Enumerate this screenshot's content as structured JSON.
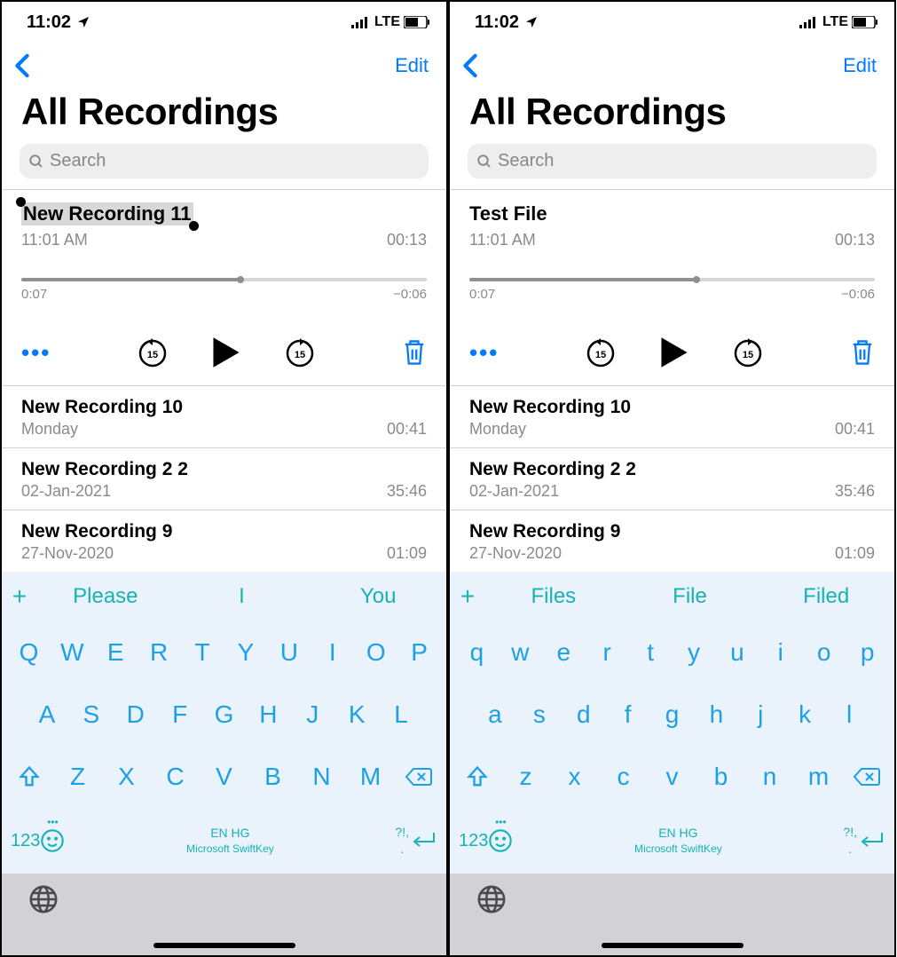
{
  "screens": [
    {
      "status": {
        "time": "11:02",
        "network": "LTE"
      },
      "nav": {
        "edit": "Edit"
      },
      "title": "All Recordings",
      "search_placeholder": "Search",
      "expanded": {
        "title": "New Recording 11",
        "title_selected": true,
        "time": "11:01 AM",
        "duration": "00:13",
        "elapsed": "0:07",
        "remaining": "−0:06",
        "progress": 0.54
      },
      "rows": [
        {
          "title": "New Recording 10",
          "date": "Monday",
          "dur": "00:41"
        },
        {
          "title": "New Recording 2 2",
          "date": "02-Jan-2021",
          "dur": "35:46"
        },
        {
          "title": "New Recording 9",
          "date": "27-Nov-2020",
          "dur": "01:09"
        }
      ],
      "suggestions": [
        "Please",
        "I",
        "You"
      ],
      "kb_rows": [
        [
          "Q",
          "W",
          "E",
          "R",
          "T",
          "Y",
          "U",
          "I",
          "O",
          "P"
        ],
        [
          "A",
          "S",
          "D",
          "F",
          "G",
          "H",
          "J",
          "K",
          "L"
        ],
        [
          "Z",
          "X",
          "C",
          "V",
          "B",
          "N",
          "M"
        ]
      ],
      "kb_bottom": {
        "num": "123",
        "lang": "EN HG",
        "brand": "Microsoft SwiftKey",
        "punct_top": "?!,",
        "punct_bot": "."
      }
    },
    {
      "status": {
        "time": "11:02",
        "network": "LTE"
      },
      "nav": {
        "edit": "Edit"
      },
      "title": "All Recordings",
      "search_placeholder": "Search",
      "expanded": {
        "title": "Test File",
        "title_selected": false,
        "time": "11:01 AM",
        "duration": "00:13",
        "elapsed": "0:07",
        "remaining": "−0:06",
        "progress": 0.56
      },
      "rows": [
        {
          "title": "New Recording 10",
          "date": "Monday",
          "dur": "00:41"
        },
        {
          "title": "New Recording 2 2",
          "date": "02-Jan-2021",
          "dur": "35:46"
        },
        {
          "title": "New Recording 9",
          "date": "27-Nov-2020",
          "dur": "01:09"
        }
      ],
      "suggestions": [
        "Files",
        "File",
        "Filed"
      ],
      "kb_rows": [
        [
          "q",
          "w",
          "e",
          "r",
          "t",
          "y",
          "u",
          "i",
          "o",
          "p"
        ],
        [
          "a",
          "s",
          "d",
          "f",
          "g",
          "h",
          "j",
          "k",
          "l"
        ],
        [
          "z",
          "x",
          "c",
          "v",
          "b",
          "n",
          "m"
        ]
      ],
      "kb_bottom": {
        "num": "123",
        "lang": "EN HG",
        "brand": "Microsoft SwiftKey",
        "punct_top": "?!,",
        "punct_bot": "."
      }
    }
  ]
}
